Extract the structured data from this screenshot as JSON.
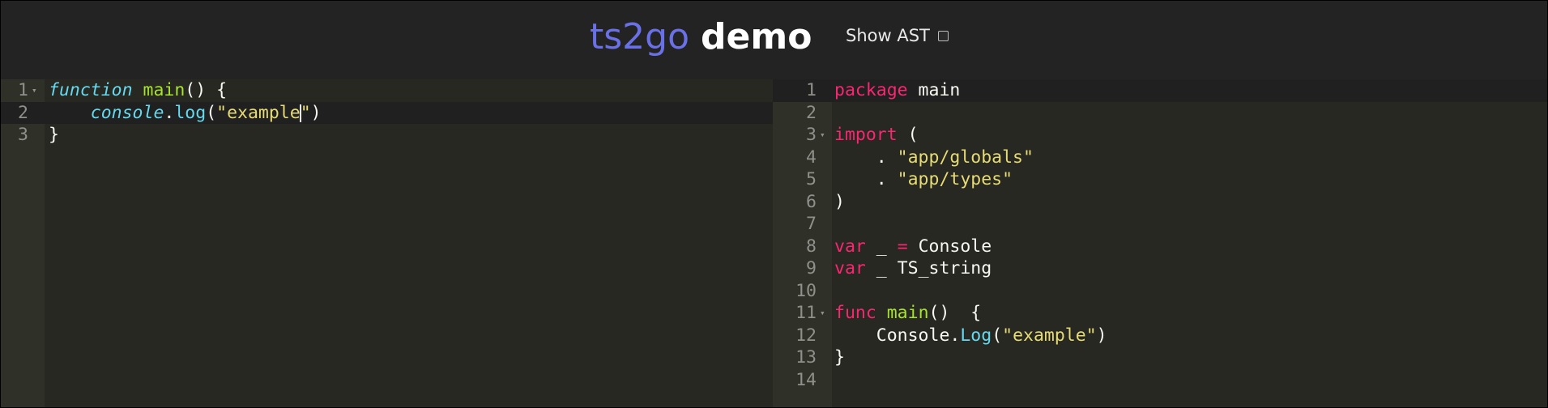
{
  "header": {
    "title_part1": "ts2go",
    "title_part2": "demo",
    "show_ast_label": "Show AST",
    "show_ast_checked": false
  },
  "left_editor": {
    "language": "typescript",
    "active_line": 2,
    "lines": [
      {
        "number": "1",
        "foldable": true
      },
      {
        "number": "2",
        "foldable": false
      },
      {
        "number": "3",
        "foldable": false
      }
    ],
    "tokens": {
      "l1_kw": "function",
      "l1_fn": "main",
      "l1_rest": "() {",
      "l2_indent": "    ",
      "l2_obj": "console",
      "l2_dot": ".",
      "l2_method": "log",
      "l2_paren_open": "(",
      "l2_str_before_cursor": "\"example",
      "l2_str_after_cursor": "\"",
      "l2_paren_close": ")",
      "l3": "}"
    }
  },
  "right_editor": {
    "language": "go",
    "active_line": 1,
    "lines": [
      {
        "number": "1",
        "foldable": false
      },
      {
        "number": "2",
        "foldable": false
      },
      {
        "number": "3",
        "foldable": true
      },
      {
        "number": "4",
        "foldable": false
      },
      {
        "number": "5",
        "foldable": false
      },
      {
        "number": "6",
        "foldable": false
      },
      {
        "number": "7",
        "foldable": false
      },
      {
        "number": "8",
        "foldable": false
      },
      {
        "number": "9",
        "foldable": false
      },
      {
        "number": "10",
        "foldable": false
      },
      {
        "number": "11",
        "foldable": true
      },
      {
        "number": "12",
        "foldable": false
      },
      {
        "number": "13",
        "foldable": false
      },
      {
        "number": "14",
        "foldable": false
      }
    ],
    "tokens": {
      "l1_kw": "package",
      "l1_rest": " main",
      "l3_kw": "import",
      "l3_rest": " (",
      "l4_prefix": "    . ",
      "l4_str": "\"app/globals\"",
      "l5_prefix": "    . ",
      "l5_str": "\"app/types\"",
      "l6": ")",
      "l8_kw": "var",
      "l8_mid": " _ ",
      "l8_op": "=",
      "l8_rest": " Console",
      "l9_kw": "var",
      "l9_rest": " _ TS_string",
      "l11_kw": "func",
      "l11_sp": " ",
      "l11_fn": "main",
      "l11_rest": "()  {",
      "l12_indent": "    ",
      "l12_obj": "Console.",
      "l12_method": "Log",
      "l12_open": "(",
      "l12_str": "\"example\"",
      "l12_close": ")",
      "l13": "}"
    }
  },
  "colors": {
    "editor_background": "#272822",
    "gutter_background": "#2f3129",
    "keyword": "#f92672",
    "function_name": "#a6e22e",
    "string": "#e6db74",
    "support": "#66d9ef",
    "title_accent": "#6a71e6"
  }
}
